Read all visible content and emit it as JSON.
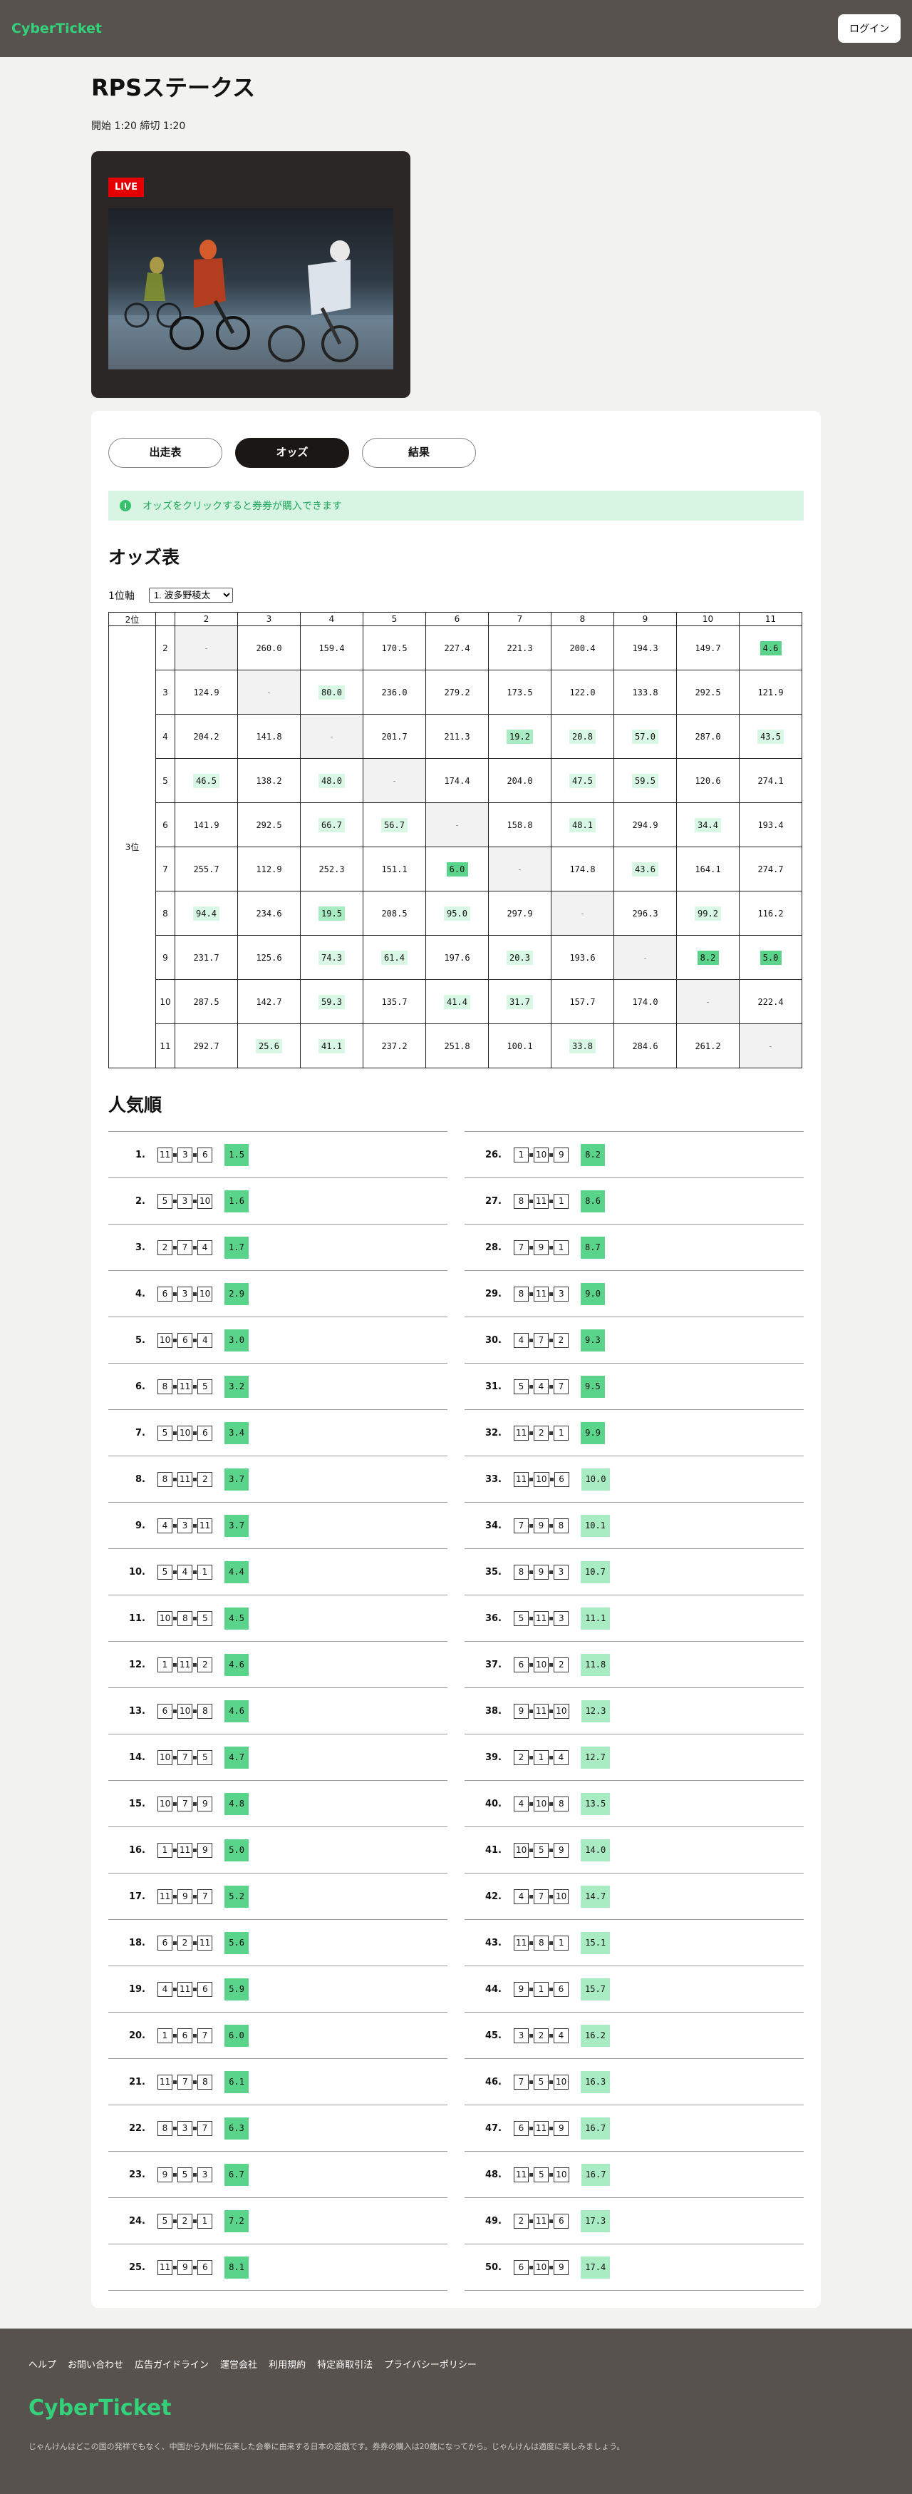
{
  "header": {
    "logo": "CyberTicket",
    "login_label": "ログイン"
  },
  "race": {
    "title": "RPSステークス",
    "meta": "開始 1:20 締切 1:20",
    "live_label": "LIVE"
  },
  "tabs": [
    {
      "label": "出走表",
      "active": false
    },
    {
      "label": "オッズ",
      "active": true
    },
    {
      "label": "結果",
      "active": false
    }
  ],
  "notice": "オッズをクリックすると券券が購入できます",
  "odds_section": {
    "title": "オッズ表",
    "axis_label": "1位軸",
    "axis_selected": "1. 波多野稜太",
    "corner_label": "2位",
    "side_label": "3位",
    "col_headers": [
      "2",
      "3",
      "4",
      "5",
      "6",
      "7",
      "8",
      "9",
      "10",
      "11"
    ],
    "rows": [
      {
        "label": "2",
        "cells": [
          "-",
          "260.0",
          "159.4",
          "170.5",
          "227.4",
          "221.3",
          "200.4",
          "194.3",
          "149.7",
          "4.6"
        ]
      },
      {
        "label": "3",
        "cells": [
          "124.9",
          "-",
          "80.0",
          "236.0",
          "279.2",
          "173.5",
          "122.0",
          "133.8",
          "292.5",
          "121.9"
        ]
      },
      {
        "label": "4",
        "cells": [
          "204.2",
          "141.8",
          "-",
          "201.7",
          "211.3",
          "19.2",
          "20.8",
          "57.0",
          "287.0",
          "43.5"
        ]
      },
      {
        "label": "5",
        "cells": [
          "46.5",
          "138.2",
          "48.0",
          "-",
          "174.4",
          "204.0",
          "47.5",
          "59.5",
          "120.6",
          "274.1"
        ]
      },
      {
        "label": "6",
        "cells": [
          "141.9",
          "292.5",
          "66.7",
          "56.7",
          "-",
          "158.8",
          "48.1",
          "294.9",
          "34.4",
          "193.4"
        ]
      },
      {
        "label": "7",
        "cells": [
          "255.7",
          "112.9",
          "252.3",
          "151.1",
          "6.0",
          "-",
          "174.8",
          "43.6",
          "164.1",
          "274.7"
        ]
      },
      {
        "label": "8",
        "cells": [
          "94.4",
          "234.6",
          "19.5",
          "208.5",
          "95.0",
          "297.9",
          "-",
          "296.3",
          "99.2",
          "116.2"
        ]
      },
      {
        "label": "9",
        "cells": [
          "231.7",
          "125.6",
          "74.3",
          "61.4",
          "197.6",
          "20.3",
          "193.6",
          "-",
          "8.2",
          "5.0"
        ]
      },
      {
        "label": "10",
        "cells": [
          "287.5",
          "142.7",
          "59.3",
          "135.7",
          "41.4",
          "31.7",
          "157.7",
          "174.0",
          "-",
          "222.4"
        ]
      },
      {
        "label": "11",
        "cells": [
          "292.7",
          "25.6",
          "41.1",
          "237.2",
          "251.8",
          "100.1",
          "33.8",
          "284.6",
          "261.2",
          "-"
        ]
      }
    ]
  },
  "popular": {
    "title": "人気順",
    "items": [
      {
        "rank": "1.",
        "nums": [
          "11",
          "3",
          "6"
        ],
        "odds": "1.5"
      },
      {
        "rank": "2.",
        "nums": [
          "5",
          "3",
          "10"
        ],
        "odds": "1.6"
      },
      {
        "rank": "3.",
        "nums": [
          "2",
          "7",
          "4"
        ],
        "odds": "1.7"
      },
      {
        "rank": "4.",
        "nums": [
          "6",
          "3",
          "10"
        ],
        "odds": "2.9"
      },
      {
        "rank": "5.",
        "nums": [
          "10",
          "6",
          "4"
        ],
        "odds": "3.0"
      },
      {
        "rank": "6.",
        "nums": [
          "8",
          "11",
          "5"
        ],
        "odds": "3.2"
      },
      {
        "rank": "7.",
        "nums": [
          "5",
          "10",
          "6"
        ],
        "odds": "3.4"
      },
      {
        "rank": "8.",
        "nums": [
          "8",
          "11",
          "2"
        ],
        "odds": "3.7"
      },
      {
        "rank": "9.",
        "nums": [
          "4",
          "3",
          "11"
        ],
        "odds": "3.7"
      },
      {
        "rank": "10.",
        "nums": [
          "5",
          "4",
          "1"
        ],
        "odds": "4.4"
      },
      {
        "rank": "11.",
        "nums": [
          "10",
          "8",
          "5"
        ],
        "odds": "4.5"
      },
      {
        "rank": "12.",
        "nums": [
          "1",
          "11",
          "2"
        ],
        "odds": "4.6"
      },
      {
        "rank": "13.",
        "nums": [
          "6",
          "10",
          "8"
        ],
        "odds": "4.6"
      },
      {
        "rank": "14.",
        "nums": [
          "10",
          "7",
          "5"
        ],
        "odds": "4.7"
      },
      {
        "rank": "15.",
        "nums": [
          "10",
          "7",
          "9"
        ],
        "odds": "4.8"
      },
      {
        "rank": "16.",
        "nums": [
          "1",
          "11",
          "9"
        ],
        "odds": "5.0"
      },
      {
        "rank": "17.",
        "nums": [
          "11",
          "9",
          "7"
        ],
        "odds": "5.2"
      },
      {
        "rank": "18.",
        "nums": [
          "6",
          "2",
          "11"
        ],
        "odds": "5.6"
      },
      {
        "rank": "19.",
        "nums": [
          "4",
          "11",
          "6"
        ],
        "odds": "5.9"
      },
      {
        "rank": "20.",
        "nums": [
          "1",
          "6",
          "7"
        ],
        "odds": "6.0"
      },
      {
        "rank": "21.",
        "nums": [
          "11",
          "7",
          "8"
        ],
        "odds": "6.1"
      },
      {
        "rank": "22.",
        "nums": [
          "8",
          "3",
          "7"
        ],
        "odds": "6.3"
      },
      {
        "rank": "23.",
        "nums": [
          "9",
          "5",
          "3"
        ],
        "odds": "6.7"
      },
      {
        "rank": "24.",
        "nums": [
          "5",
          "2",
          "1"
        ],
        "odds": "7.2"
      },
      {
        "rank": "25.",
        "nums": [
          "11",
          "9",
          "6"
        ],
        "odds": "8.1"
      },
      {
        "rank": "26.",
        "nums": [
          "1",
          "10",
          "9"
        ],
        "odds": "8.2"
      },
      {
        "rank": "27.",
        "nums": [
          "8",
          "11",
          "1"
        ],
        "odds": "8.6"
      },
      {
        "rank": "28.",
        "nums": [
          "7",
          "9",
          "1"
        ],
        "odds": "8.7"
      },
      {
        "rank": "29.",
        "nums": [
          "8",
          "11",
          "3"
        ],
        "odds": "9.0"
      },
      {
        "rank": "30.",
        "nums": [
          "4",
          "7",
          "2"
        ],
        "odds": "9.3"
      },
      {
        "rank": "31.",
        "nums": [
          "5",
          "4",
          "7"
        ],
        "odds": "9.5"
      },
      {
        "rank": "32.",
        "nums": [
          "11",
          "2",
          "1"
        ],
        "odds": "9.9"
      },
      {
        "rank": "33.",
        "nums": [
          "11",
          "10",
          "6"
        ],
        "odds": "10.0"
      },
      {
        "rank": "34.",
        "nums": [
          "7",
          "9",
          "8"
        ],
        "odds": "10.1"
      },
      {
        "rank": "35.",
        "nums": [
          "8",
          "9",
          "3"
        ],
        "odds": "10.7"
      },
      {
        "rank": "36.",
        "nums": [
          "5",
          "11",
          "3"
        ],
        "odds": "11.1"
      },
      {
        "rank": "37.",
        "nums": [
          "6",
          "10",
          "2"
        ],
        "odds": "11.8"
      },
      {
        "rank": "38.",
        "nums": [
          "9",
          "11",
          "10"
        ],
        "odds": "12.3"
      },
      {
        "rank": "39.",
        "nums": [
          "2",
          "1",
          "4"
        ],
        "odds": "12.7"
      },
      {
        "rank": "40.",
        "nums": [
          "4",
          "10",
          "8"
        ],
        "odds": "13.5"
      },
      {
        "rank": "41.",
        "nums": [
          "10",
          "5",
          "9"
        ],
        "odds": "14.0"
      },
      {
        "rank": "42.",
        "nums": [
          "4",
          "7",
          "10"
        ],
        "odds": "14.7"
      },
      {
        "rank": "43.",
        "nums": [
          "11",
          "8",
          "1"
        ],
        "odds": "15.1"
      },
      {
        "rank": "44.",
        "nums": [
          "9",
          "1",
          "6"
        ],
        "odds": "15.7"
      },
      {
        "rank": "45.",
        "nums": [
          "3",
          "2",
          "4"
        ],
        "odds": "16.2"
      },
      {
        "rank": "46.",
        "nums": [
          "7",
          "5",
          "10"
        ],
        "odds": "16.3"
      },
      {
        "rank": "47.",
        "nums": [
          "6",
          "11",
          "9"
        ],
        "odds": "16.7"
      },
      {
        "rank": "48.",
        "nums": [
          "11",
          "5",
          "10"
        ],
        "odds": "16.7"
      },
      {
        "rank": "49.",
        "nums": [
          "2",
          "11",
          "6"
        ],
        "odds": "17.3"
      },
      {
        "rank": "50.",
        "nums": [
          "6",
          "10",
          "9"
        ],
        "odds": "17.4"
      }
    ]
  },
  "footer": {
    "links": [
      "ヘルプ",
      "お問い合わせ",
      "広告ガイドライン",
      "運営会社",
      "利用規約",
      "特定商取引法",
      "プライバシーポリシー"
    ],
    "logo": "CyberTicket",
    "description": "じゃんけんはどこの国の発祥でもなく、中国から九州に伝来した会拳に由来する日本の遊戯です。券券の購入は20歳になってから。じゃんけんは適度に楽しみましょう。"
  },
  "colors": {
    "accent": "#33d17a",
    "header_bg": "#57524d",
    "odds_strong": "#5ad48a",
    "odds_mid": "#a9ecc4",
    "odds_light": "#d8f7e4"
  }
}
